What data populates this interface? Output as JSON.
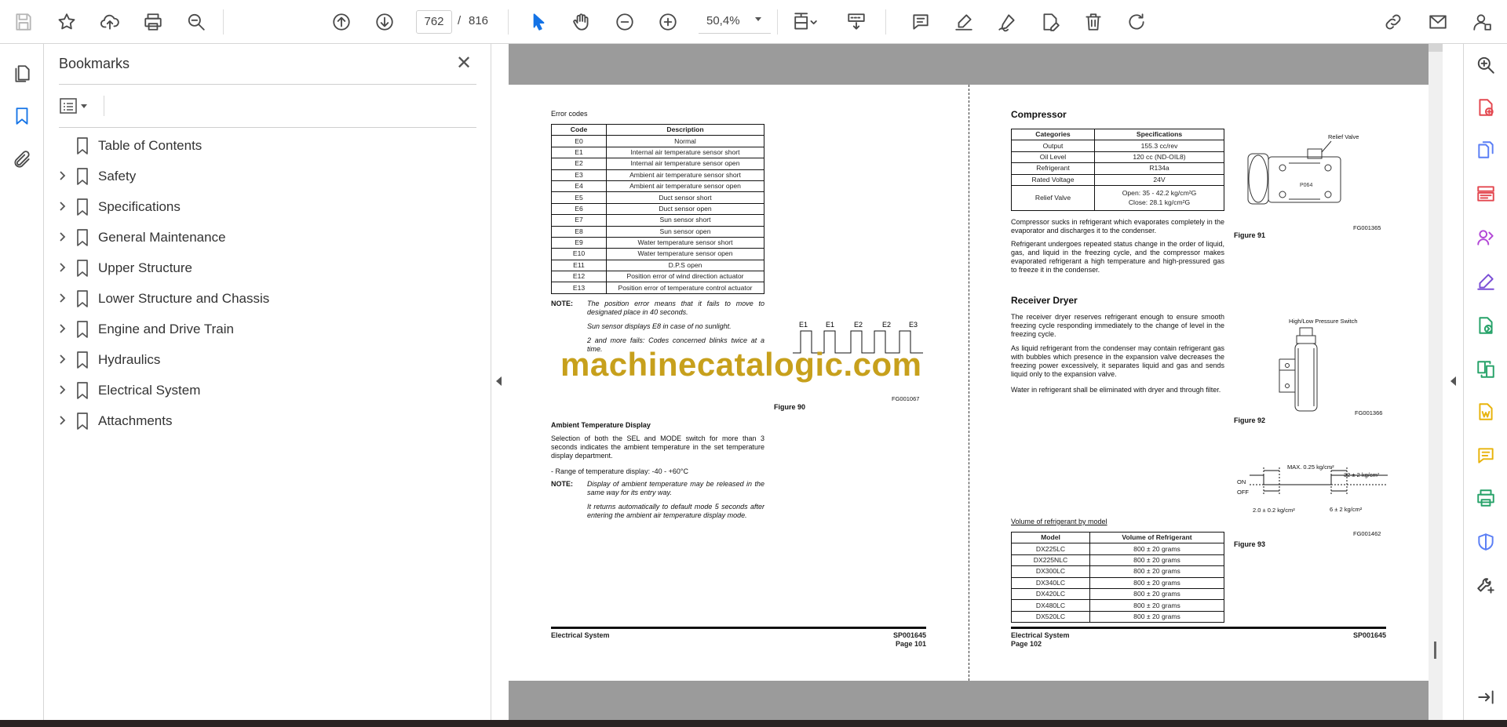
{
  "toolbar": {
    "left_icons": [
      "save-icon",
      "bookmark-star-icon",
      "upload-icon",
      "print-icon",
      "zoom-search-icon"
    ],
    "nav_icons": [
      "page-up-icon",
      "page-down-icon"
    ],
    "current_page": "762",
    "page_separator": "/",
    "total_pages": "816",
    "tool_icons": [
      "select-arrow-icon",
      "hand-icon",
      "zoom-out-icon",
      "zoom-in-icon"
    ],
    "zoom_value": "50,4%",
    "right_icons": [
      "fit-page-icon",
      "scroll-mode-icon",
      "comment-icon",
      "highlight-icon",
      "sign-icon",
      "edit-pdf-icon",
      "delete-icon",
      "rotate-icon",
      "link-icon",
      "mail-icon",
      "account-icon"
    ]
  },
  "left_rail": [
    "pages-icon",
    "bookmarks-icon",
    "attachments-icon"
  ],
  "bookmarks": {
    "title": "Bookmarks",
    "close_symbol": "✕",
    "items": [
      {
        "label": "Table of Contents",
        "expandable": false
      },
      {
        "label": "Safety",
        "expandable": true
      },
      {
        "label": "Specifications",
        "expandable": true
      },
      {
        "label": "General Maintenance",
        "expandable": true
      },
      {
        "label": "Upper Structure",
        "expandable": true
      },
      {
        "label": "Lower Structure and Chassis",
        "expandable": true
      },
      {
        "label": "Engine and Drive Train",
        "expandable": true
      },
      {
        "label": "Hydraulics",
        "expandable": true
      },
      {
        "label": "Electrical System",
        "expandable": true
      },
      {
        "label": "Attachments",
        "expandable": true
      }
    ]
  },
  "document": {
    "watermark": "machinecatalogic.com",
    "left_page": {
      "error_codes_heading": "Error codes",
      "table_headers": [
        "Code",
        "Description"
      ],
      "rows": [
        [
          "E0",
          "Normal"
        ],
        [
          "E1",
          "Internal air temperature sensor short"
        ],
        [
          "E2",
          "Internal air temperature sensor open"
        ],
        [
          "E3",
          "Ambient air temperature sensor short"
        ],
        [
          "E4",
          "Ambient air temperature sensor open"
        ],
        [
          "E5",
          "Duct sensor short"
        ],
        [
          "E6",
          "Duct sensor open"
        ],
        [
          "E7",
          "Sun sensor short"
        ],
        [
          "E8",
          "Sun sensor open"
        ],
        [
          "E9",
          "Water temperature sensor short"
        ],
        [
          "E10",
          "Water temperature sensor open"
        ],
        [
          "E11",
          "D.P.S open"
        ],
        [
          "E12",
          "Position error of wind direction actuator"
        ],
        [
          "E13",
          "Position error of temperature control actuator"
        ]
      ],
      "note_label": "NOTE:",
      "note1": "The position error means that it fails to move to designated place in 40 seconds.",
      "note2": "Sun sensor displays E8 in case of no sunlight.",
      "note3": "2 and more fails: Codes concerned blinks twice at a time.",
      "wave_labels": [
        "E1",
        "E1",
        "E2",
        "E2",
        "E3"
      ],
      "fig_code": "FG001067",
      "fig_caption": "Figure 90",
      "ambient_heading": "Ambient Temperature Display",
      "ambient_text": "Selection of both the SEL and MODE switch for more than 3 seconds indicates the ambient temperature in the set temperature display department.",
      "range_text": "- Range of temperature display: -40 - +60°C",
      "note4": "Display of ambient temperature may be released in the same way for its entry way.",
      "note5": "It returns automatically to default mode 5 seconds after entering the ambient air temperature display mode.",
      "footer_left": "Electrical System",
      "footer_code": "SP001645",
      "footer_page": "Page 101"
    },
    "right_page": {
      "compressor_heading": "Compressor",
      "spec_headers": [
        "Categories",
        "Specifications"
      ],
      "spec_rows": [
        [
          "Output",
          "155.3 cc/rev"
        ],
        [
          "Oil Level",
          "120 cc (ND-OIL8)"
        ],
        [
          "Refrigerant",
          "R134a"
        ],
        [
          "Rated Voltage",
          "24V"
        ]
      ],
      "relief_label": "Relief Valve",
      "relief_open": "Open: 35 - 42.2 kg/cm²G",
      "relief_close": "Close: 28.1 kg/cm²G",
      "comp_text1": "Compressor sucks in refrigerant which evaporates completely in the evaporator and discharges it to the condenser.",
      "comp_text2": "Refrigerant undergoes repeated status change in the order of liquid, gas, and liquid in the freezing cycle, and the compressor makes evaporated refrigerant a high temperature and high-pressured gas to freeze it in the condenser.",
      "fig91_label": "Relief Valve",
      "fig91_code": "FG001365",
      "fig91_caption": "Figure 91",
      "fig91_part": "P064",
      "receiver_heading": "Receiver Dryer",
      "recv_text1": "The receiver dryer reserves refrigerant enough to ensure smooth freezing cycle responding immediately to the change of level in the freezing cycle.",
      "recv_text2": "As liquid refrigerant from the condenser may contain refrigerant gas with bubbles which presence in the expansion valve decreases the freezing power excessively, it separates liquid and gas and sends liquid only to the expansion valve.",
      "recv_text3": "Water in refrigerant shall be eliminated with dryer and through filter.",
      "fig92_label": "High/Low Pressure Switch",
      "fig92_code": "FG001366",
      "fig92_caption": "Figure 92",
      "fig93_max": "MAX. 0.25 kg/cm²",
      "fig93_32": "32 ± 2 kg/cm²",
      "fig93_on": "ON",
      "fig93_off": "OFF",
      "fig93_20": "2.0 ± 0.2 kg/cm²",
      "fig93_6": "6 ± 2 kg/cm²",
      "fig93_code": "FG001462",
      "fig93_caption": "Figure 93",
      "vol_heading": "Volume of refrigerant by model",
      "vol_headers": [
        "Model",
        "Volume of Refrigerant"
      ],
      "vol_rows": [
        [
          "DX225LC",
          "800 ± 20 grams"
        ],
        [
          "DX225NLC",
          "800 ± 20 grams"
        ],
        [
          "DX300LC",
          "800 ± 20 grams"
        ],
        [
          "DX340LC",
          "800 ± 20 grams"
        ],
        [
          "DX420LC",
          "800 ± 20 grams"
        ],
        [
          "DX480LC",
          "800 ± 20 grams"
        ],
        [
          "DX520LC",
          "800 ± 20 grams"
        ]
      ],
      "footer_left": "Electrical System",
      "footer_code": "SP001645",
      "footer_page": "Page 102"
    }
  },
  "right_rail": [
    {
      "icon": "zoom-search-icon",
      "color": "#444444"
    },
    {
      "icon": "export-pdf-icon",
      "color": "#e34850"
    },
    {
      "icon": "create-pdf-icon",
      "color": "#5a7ef5"
    },
    {
      "icon": "organize-pages-icon",
      "color": "#e34850"
    },
    {
      "icon": "share-icon",
      "color": "#b247d6"
    },
    {
      "icon": "fill-sign-icon",
      "color": "#7b4fd6"
    },
    {
      "icon": "send-track-icon",
      "color": "#26a269"
    },
    {
      "icon": "compare-icon",
      "color": "#26a269"
    },
    {
      "icon": "export-word-icon",
      "color": "#e8b30a"
    },
    {
      "icon": "comment-icon",
      "color": "#e8b30a"
    },
    {
      "icon": "print-production-icon",
      "color": "#26a269"
    },
    {
      "icon": "protect-icon",
      "color": "#5a7ef5"
    },
    {
      "icon": "more-tools-icon",
      "color": "#444444"
    },
    {
      "icon": "collapse-pane-icon",
      "color": "#444444"
    }
  ]
}
